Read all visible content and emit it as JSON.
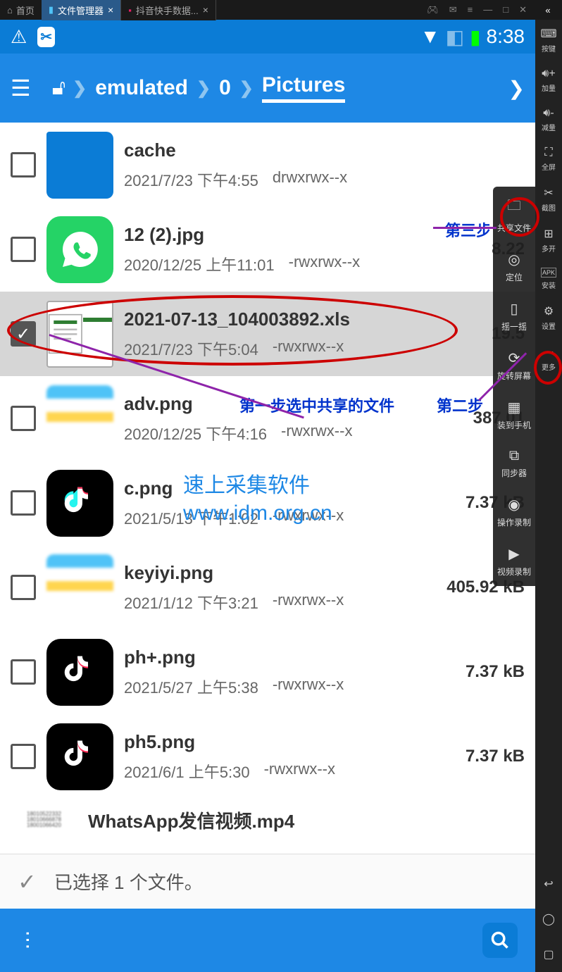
{
  "titlebar": {
    "home": "首页",
    "tab1": "文件管理器",
    "tab2": "抖音快手数据...",
    "close": "×"
  },
  "status": {
    "time": "8:38"
  },
  "breadcrumb": {
    "p1": "emulated",
    "p2": "0",
    "p3": "Pictures"
  },
  "files": [
    {
      "name": "cache",
      "date": "2021/7/23 下午4:55",
      "perm": "drwxrwx--x",
      "size": ""
    },
    {
      "name": "12 (2).jpg",
      "date": "2020/12/25 上午11:01",
      "perm": "-rwxrwx--x",
      "size": "8.22"
    },
    {
      "name": "2021-07-13_104003892.xls",
      "date": "2021/7/23 下午5:04",
      "perm": "-rwxrwx--x",
      "size": "19.5"
    },
    {
      "name": "adv.png",
      "date": "2020/12/25 下午4:16",
      "perm": "-rwxrwx--x",
      "size": "387.01"
    },
    {
      "name": "c.png",
      "date": "2021/5/13 下午1:02",
      "perm": "-rwxrwx--x",
      "size": "7.37 kB"
    },
    {
      "name": "keyiyi.png",
      "date": "2021/1/12 下午3:21",
      "perm": "-rwxrwx--x",
      "size": "405.92 kB"
    },
    {
      "name": "ph+.png",
      "date": "2021/5/27 上午5:38",
      "perm": "-rwxrwx--x",
      "size": "7.37 kB"
    },
    {
      "name": "ph5.png",
      "date": "2021/6/1 上午5:30",
      "perm": "-rwxrwx--x",
      "size": "7.37 kB"
    },
    {
      "name": "WhatsApp发信视频.mp4",
      "date": "",
      "perm": "",
      "size": ""
    }
  ],
  "selection": "已选择 1 个文件。",
  "annotations": {
    "step1": "第一步选中共享的文件",
    "step2": "第二步",
    "step3": "第三步"
  },
  "watermark": {
    "l1": "速上采集软件",
    "l2": "www.idm.org.cn"
  },
  "inner_side": [
    "共享文件",
    "定位",
    "摇一摇",
    "旋转屏幕",
    "装到手机",
    "同步器",
    "操作录制",
    "视频录制"
  ],
  "r_side": [
    "按键",
    "加量",
    "减量",
    "全屏",
    "截图",
    "多开",
    "安装",
    "设置",
    "更多"
  ]
}
